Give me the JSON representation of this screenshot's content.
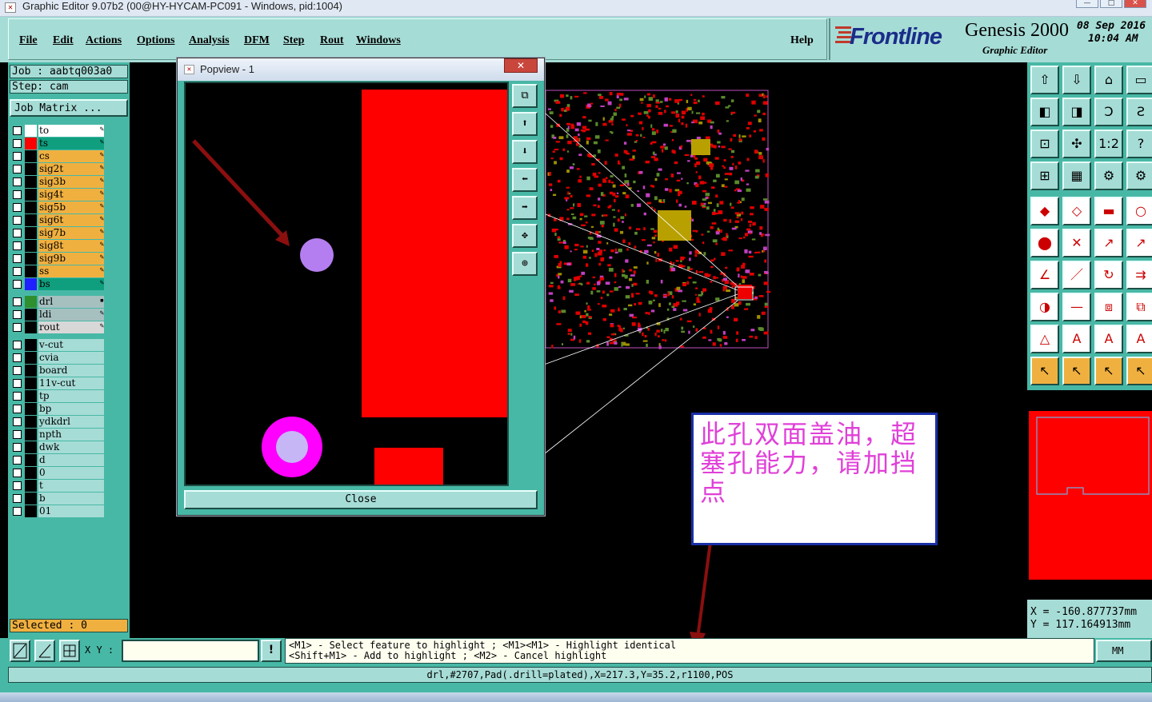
{
  "window": {
    "title": "Graphic Editor 9.07b2 (00@HY-HYCAM-PC091 - Windows, pid:1004)"
  },
  "menu": {
    "items": [
      "File",
      "Edit",
      "Actions",
      "Options",
      "Analysis",
      "DFM",
      "Step",
      "Rout",
      "Windows"
    ],
    "help": "Help"
  },
  "brand": {
    "logo": "Frontline",
    "product": "Genesis 2000",
    "subtitle": "Graphic Editor",
    "date": "08 Sep 2016",
    "time": "10:04 AM"
  },
  "left": {
    "job": "Job : aabtq003a0",
    "step": "Step: cam",
    "matrix_btn": "Job Matrix ...",
    "selected": "Selected : 0",
    "layers": [
      {
        "name": "to",
        "color": "#ffffff",
        "bg": "#ffffff"
      },
      {
        "name": "ts",
        "color": "#ff0000",
        "bg": "#0f9f7f"
      },
      {
        "name": "cs",
        "color": "#000000",
        "bg": "#f0b040"
      },
      {
        "name": "sig2t",
        "color": "#000000",
        "bg": "#f0b040"
      },
      {
        "name": "sig3b",
        "color": "#000000",
        "bg": "#f0b040"
      },
      {
        "name": "sig4t",
        "color": "#000000",
        "bg": "#f0b040"
      },
      {
        "name": "sig5b",
        "color": "#000000",
        "bg": "#f0b040"
      },
      {
        "name": "sig6t",
        "color": "#000000",
        "bg": "#f0b040"
      },
      {
        "name": "sig7b",
        "color": "#000000",
        "bg": "#f0b040"
      },
      {
        "name": "sig8t",
        "color": "#000000",
        "bg": "#f0b040"
      },
      {
        "name": "sig9b",
        "color": "#000000",
        "bg": "#f0b040"
      },
      {
        "name": "ss",
        "color": "#000000",
        "bg": "#f0b040"
      },
      {
        "name": "bs",
        "color": "#2020ff",
        "bg": "#0f9f7f"
      },
      {
        "name": "drl",
        "color": "#2f8f2f",
        "bg": "#a6c0c0"
      },
      {
        "name": "ldi",
        "color": "#000000",
        "bg": "#a6c0c0"
      },
      {
        "name": "rout",
        "color": "#000000",
        "bg": "#d8d8d8"
      },
      {
        "name": "v-cut",
        "color": "#000000",
        "bg": "#a6dcd6"
      },
      {
        "name": "cvia",
        "color": "#000000",
        "bg": "#a6dcd6"
      },
      {
        "name": "board",
        "color": "#000000",
        "bg": "#a6dcd6"
      },
      {
        "name": "11v-cut",
        "color": "#000000",
        "bg": "#a6dcd6"
      },
      {
        "name": "tp",
        "color": "#000000",
        "bg": "#a6dcd6"
      },
      {
        "name": "bp",
        "color": "#000000",
        "bg": "#a6dcd6"
      },
      {
        "name": "ydkdrl",
        "color": "#000000",
        "bg": "#a6dcd6"
      },
      {
        "name": "npth",
        "color": "#000000",
        "bg": "#a6dcd6"
      },
      {
        "name": "dwk",
        "color": "#000000",
        "bg": "#a6dcd6"
      },
      {
        "name": "d",
        "color": "#000000",
        "bg": "#a6dcd6"
      },
      {
        "name": "0",
        "color": "#000000",
        "bg": "#a6dcd6"
      },
      {
        "name": "t",
        "color": "#000000",
        "bg": "#a6dcd6"
      },
      {
        "name": "b",
        "color": "#000000",
        "bg": "#a6dcd6"
      },
      {
        "name": "01",
        "color": "#000000",
        "bg": "#a6dcd6"
      }
    ]
  },
  "popup": {
    "title": "Popview - 1",
    "close": "Close"
  },
  "note": {
    "text": "此孔双面盖油，超塞孔能力，请加挡点"
  },
  "coords": {
    "x": "X = -160.877737mm",
    "y": "Y = 117.164913mm"
  },
  "bottom": {
    "xy_label": "X Y :",
    "help_line1": "<M1> - Select feature to highlight ; <M1><M1> - Highlight identical",
    "help_line2": "<Shift+M1> - Add to highlight ; <M2> - Cancel highlight",
    "units": "MM",
    "status": "drl,#2707,Pad(.drill=plated),X=217.3,Y=35.2,r1100,POS"
  }
}
